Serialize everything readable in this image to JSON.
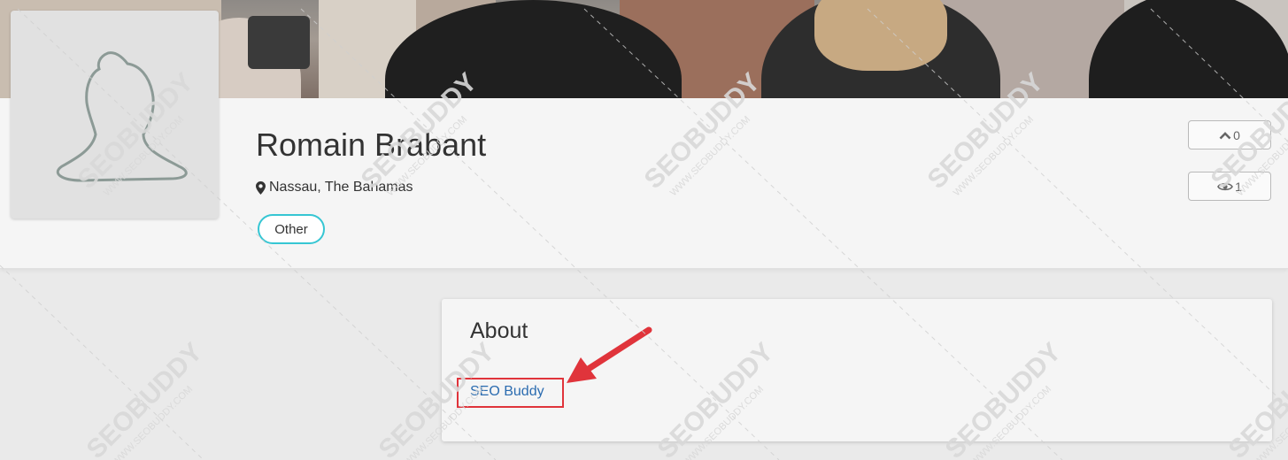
{
  "profile": {
    "name": "Romain Brabant",
    "location": "Nassau, The Bahamas",
    "tag": "Other"
  },
  "stats": {
    "upvotes": "0",
    "views": "1"
  },
  "about": {
    "title": "About",
    "link_text": "SEO Buddy"
  },
  "watermark": {
    "brand": "SEOBUDDY",
    "url": "WWW.SEOBUDDY.COM"
  },
  "icons": {
    "location": "map-marker-icon",
    "upvote": "chevron-up-icon",
    "views": "eye-icon"
  },
  "colors": {
    "tag_border": "#36c6d3",
    "link": "#2b6cb0",
    "annotation_red": "#e0343b"
  }
}
